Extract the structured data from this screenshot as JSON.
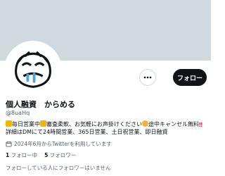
{
  "profile": {
    "name": "個人融資　からめる",
    "handle": "@8uaHq",
    "bio": {
      "line1_a": "毎日営業中",
      "line1_b": "審査柔軟、お気軽にお声掛けください",
      "line1_c": "途中キャンセル無料",
      "line2": "詳細はDMにて24時間営業、365日営業、土日祝営業、即日融資"
    },
    "joined": "2024年6月からTwitterを利用しています",
    "following_count": "1",
    "following_label": "フォロー中",
    "followers_count": "5",
    "followers_label": "フォロワー",
    "followed_by": "フォローしている人にフォロワーはいません"
  },
  "actions": {
    "follow_label": "フォロー"
  },
  "icons": {
    "more": "more-dots-icon",
    "calendar": "calendar-icon",
    "avatar": "cartoon-face-avatar"
  },
  "colors": {
    "banner": "#cfd9de",
    "follow_button": "#0f1419",
    "secondary_text": "#536471"
  }
}
